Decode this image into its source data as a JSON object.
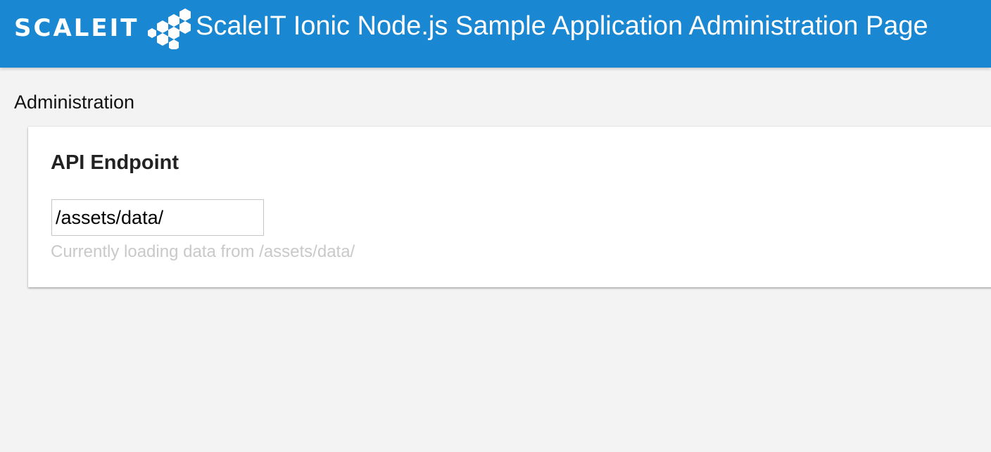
{
  "header": {
    "logo_text": "SCALEIT",
    "title": "ScaleIT Ionic Node.js Sample Application Administration Page",
    "background_color": "#1987d1"
  },
  "page": {
    "section_title": "Administration"
  },
  "api_endpoint": {
    "title": "API Endpoint",
    "input_value": "/assets/data/",
    "helper_text": "Currently loading data from /assets/data/"
  }
}
